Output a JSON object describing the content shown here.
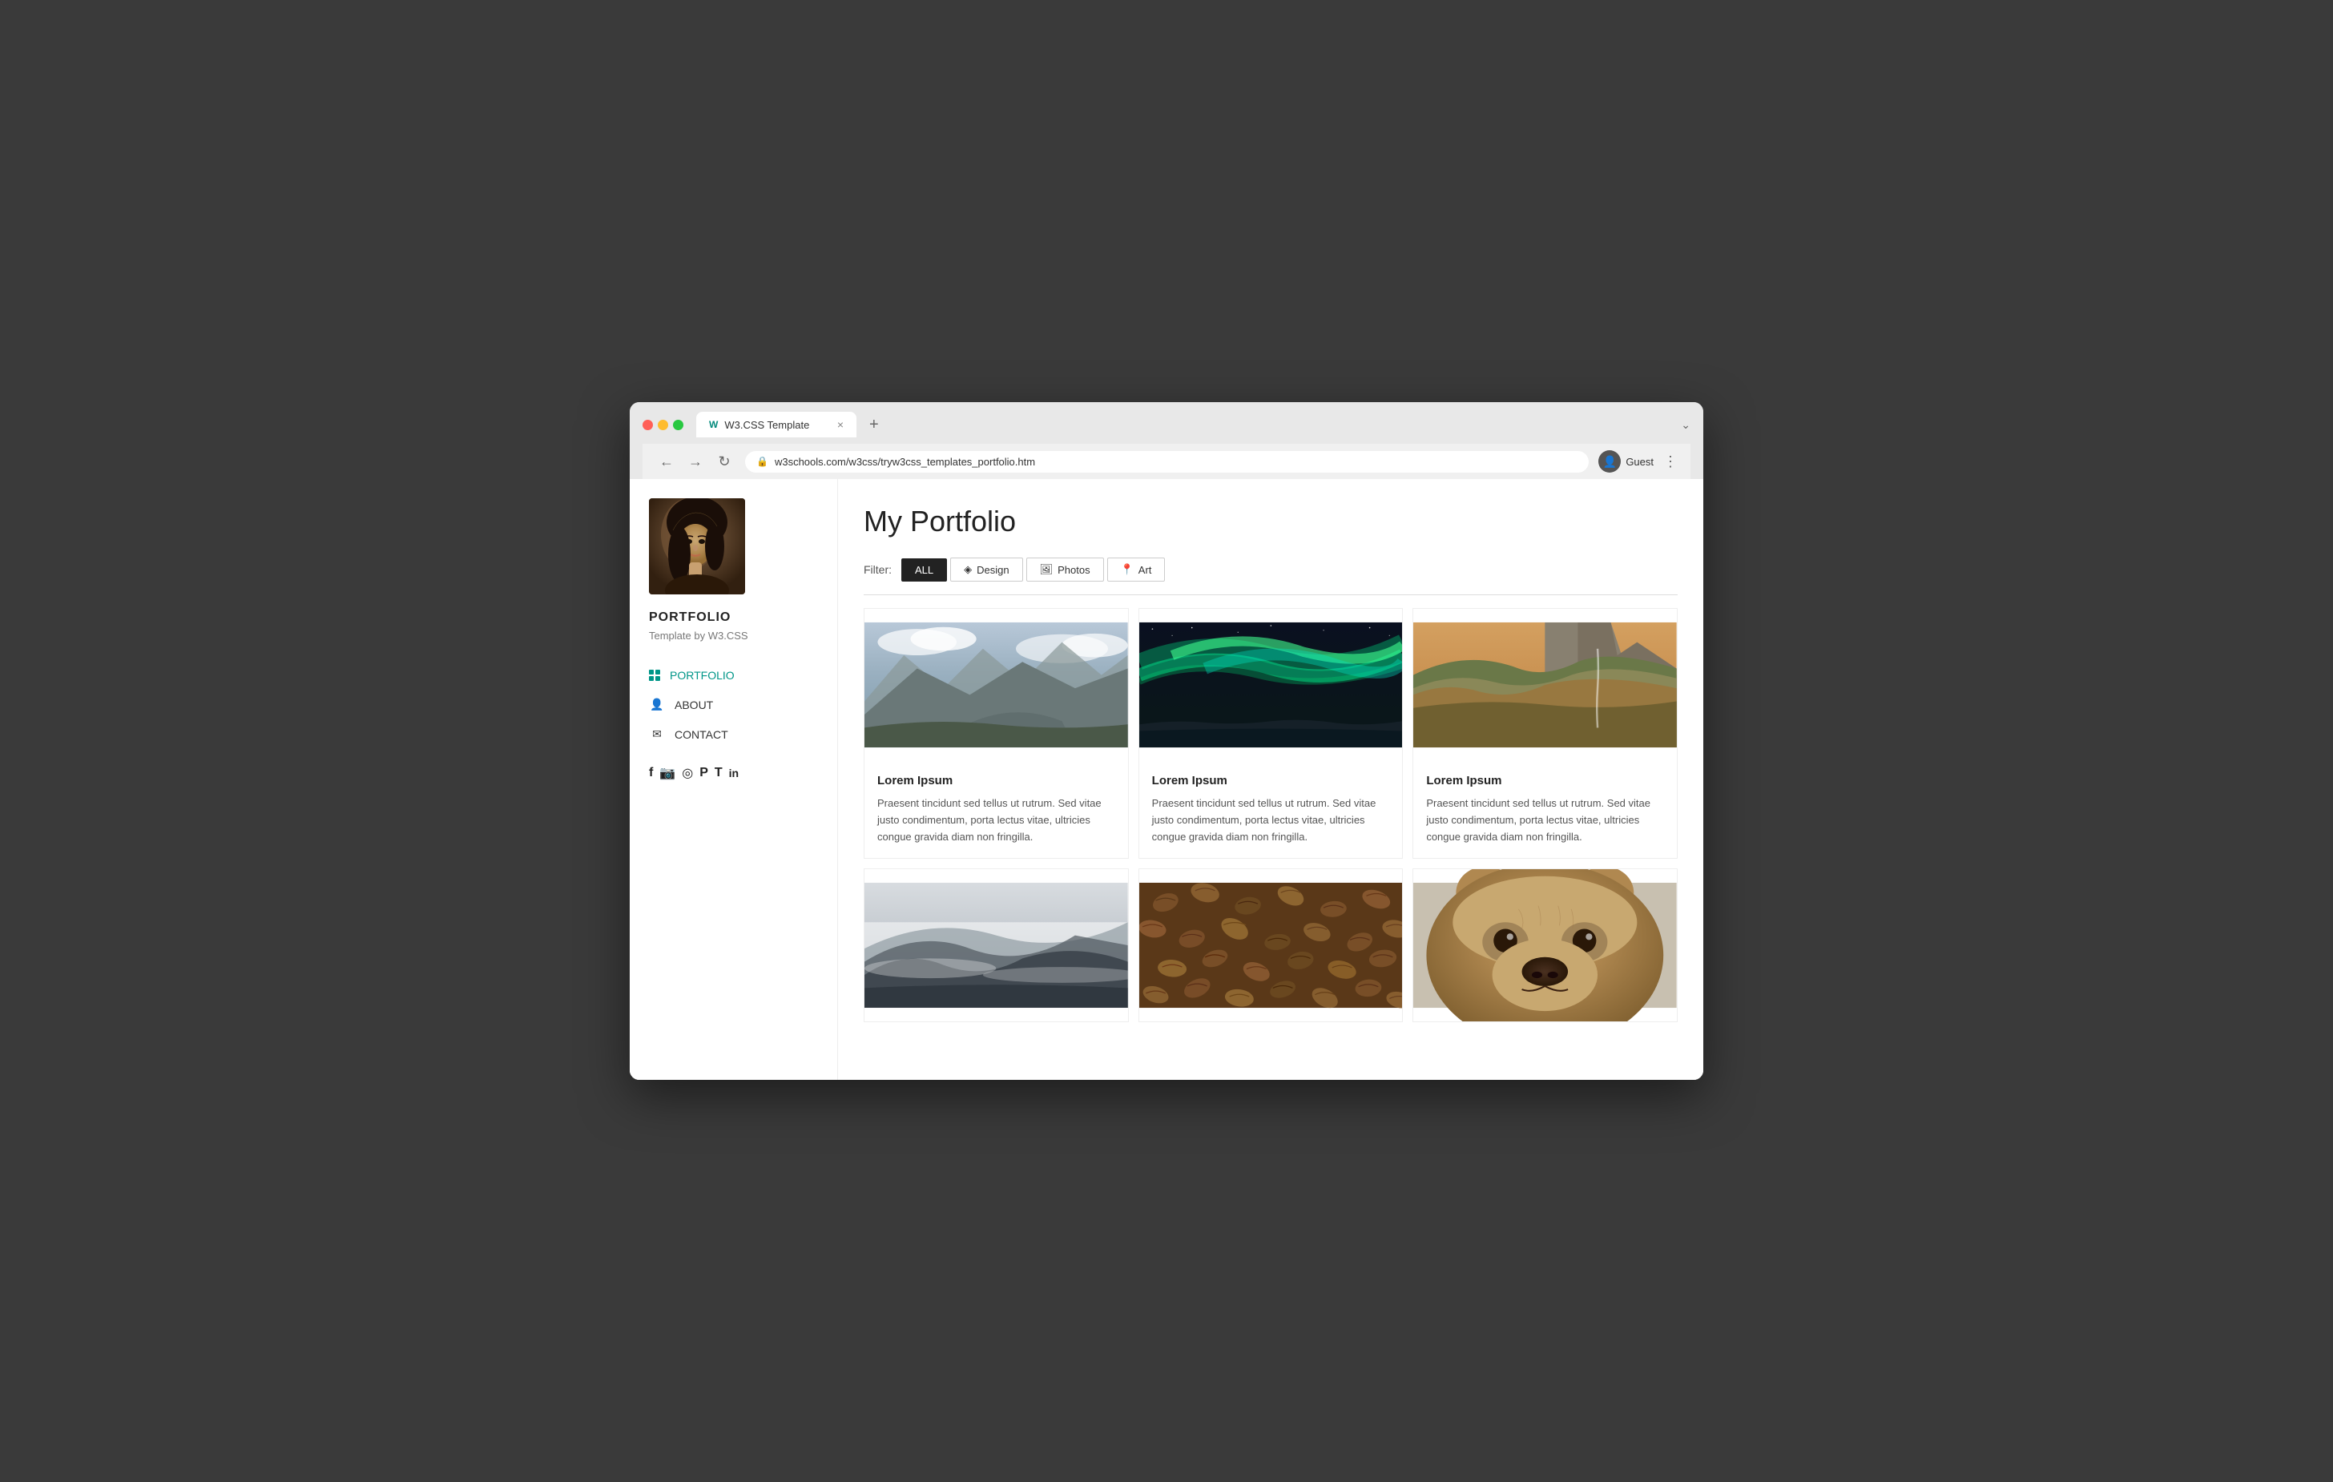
{
  "browser": {
    "tab_favicon": "W",
    "tab_title": "W3.CSS Template",
    "tab_close": "×",
    "tab_new": "+",
    "tab_menu": "⌄",
    "nav_back": "←",
    "nav_forward": "→",
    "nav_refresh": "↻",
    "address_url": "w3schools.com/w3css/tryw3css_templates_portfolio.htm",
    "profile_label": "Guest",
    "browser_menu": "⋮"
  },
  "sidebar": {
    "brand": "PORTFOLIO",
    "tagline": "Template by W3.CSS",
    "nav_items": [
      {
        "id": "portfolio",
        "label": "PORTFOLIO",
        "icon": "grid",
        "active": true
      },
      {
        "id": "about",
        "label": "ABOUT",
        "icon": "person"
      },
      {
        "id": "contact",
        "label": "CONTACT",
        "icon": "mail"
      }
    ],
    "social_icons": [
      "f",
      "📷",
      "◎",
      "𝗽",
      "𝗧",
      "in"
    ]
  },
  "main": {
    "page_title": "My Portfolio",
    "filter_label": "Filter:",
    "filter_buttons": [
      {
        "id": "all",
        "label": "ALL",
        "active": true
      },
      {
        "id": "design",
        "label": "Design",
        "icon": "◈"
      },
      {
        "id": "photos",
        "label": "Photos",
        "icon": "🖼"
      },
      {
        "id": "art",
        "label": "Art",
        "icon": "📍"
      }
    ],
    "cards": [
      {
        "id": "card1",
        "title": "Lorem Ipsum",
        "text": "Praesent tincidunt sed tellus ut rutrum. Sed vitae justo condimentum, porta lectus vitae, ultricies congue gravida diam non fringilla.",
        "type": "mountains"
      },
      {
        "id": "card2",
        "title": "Lorem Ipsum",
        "text": "Praesent tincidunt sed tellus ut rutrum. Sed vitae justo condimentum, porta lectus vitae, ultricies congue gravida diam non fringilla.",
        "type": "aurora"
      },
      {
        "id": "card3",
        "title": "Lorem Ipsum",
        "text": "Praesent tincidunt sed tellus ut rutrum. Sed vitae justo condimentum, porta lectus vitae, ultricies congue gravida diam non fringilla.",
        "type": "autumn"
      },
      {
        "id": "card4",
        "title": "",
        "text": "",
        "type": "mist"
      },
      {
        "id": "card5",
        "title": "",
        "text": "",
        "type": "coffee"
      },
      {
        "id": "card6",
        "title": "",
        "text": "",
        "type": "bear"
      }
    ]
  }
}
